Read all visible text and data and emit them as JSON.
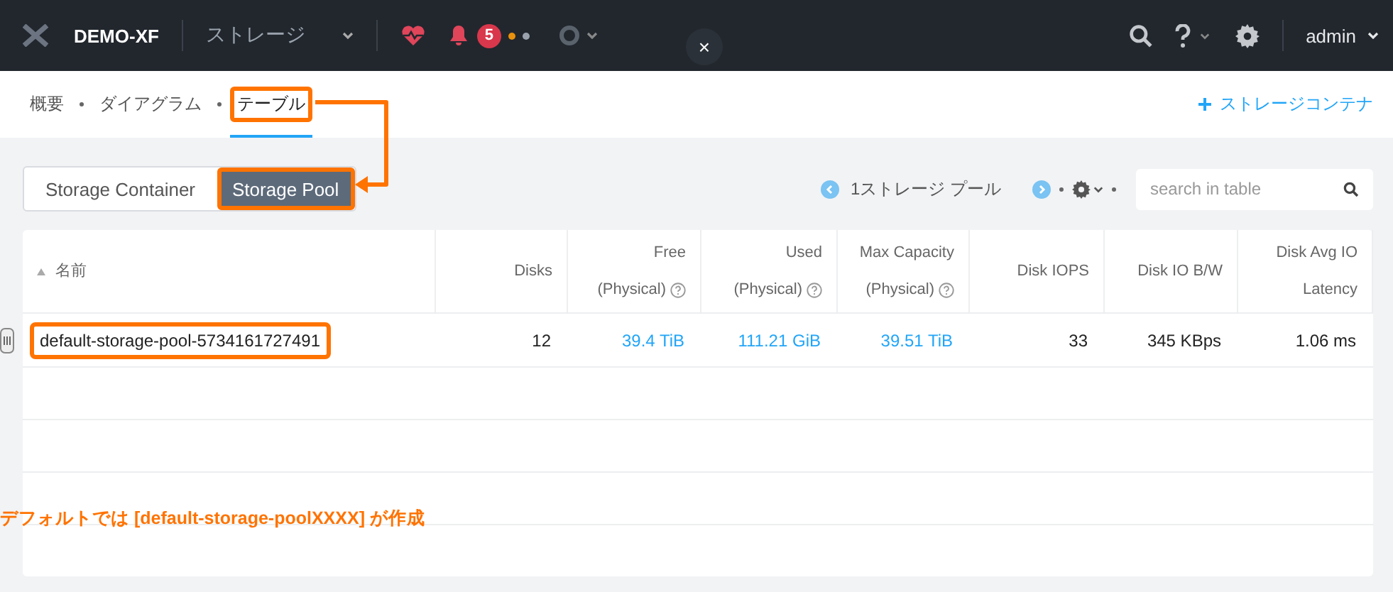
{
  "header": {
    "cluster": "DEMO-XF",
    "view": "ストレージ",
    "alert_count": "5",
    "user": "admin"
  },
  "close_button": {
    "label": "×"
  },
  "nav_tabs": [
    {
      "label": "概要",
      "selected": false,
      "highlighted": false
    },
    {
      "label": "ダイアグラム",
      "selected": false,
      "highlighted": false
    },
    {
      "label": "テーブル",
      "selected": true,
      "highlighted": true
    }
  ],
  "add_link": {
    "label": "ストレージコンテナ"
  },
  "segments": [
    {
      "label": "Storage Container",
      "selected": false,
      "highlighted": false
    },
    {
      "label": "Storage Pool",
      "selected": true,
      "highlighted": true
    }
  ],
  "pager": {
    "label": "1ストレージ プール"
  },
  "search": {
    "placeholder": "search in table"
  },
  "table": {
    "columns": [
      {
        "label": "名前",
        "sortable": true,
        "help": false,
        "kind": "name"
      },
      {
        "label": "Disks",
        "sortable": false,
        "help": false,
        "kind": "text"
      },
      {
        "label": "Free (Physical)",
        "sortable": false,
        "help": true,
        "kind": "link"
      },
      {
        "label": "Used (Physical)",
        "sortable": false,
        "help": true,
        "kind": "link"
      },
      {
        "label": "Max Capacity (Physical)",
        "sortable": false,
        "help": true,
        "kind": "link"
      },
      {
        "label": "Disk IOPS",
        "sortable": false,
        "help": false,
        "kind": "text"
      },
      {
        "label": "Disk IO B/W",
        "sortable": false,
        "help": false,
        "kind": "text"
      },
      {
        "label": "Disk Avg IO Latency",
        "sortable": false,
        "help": false,
        "kind": "text"
      }
    ],
    "rows": [
      {
        "highlighted": true,
        "cells": [
          "default-storage-pool-5734161727491",
          "12",
          "39.4 TiB",
          "111.21 GiB",
          "39.51 TiB",
          "33",
          "345 KBps",
          "1.06 ms"
        ]
      }
    ]
  },
  "annotation": {
    "text": "デフォルトでは [default-storage-poolXXXX] が作成"
  }
}
